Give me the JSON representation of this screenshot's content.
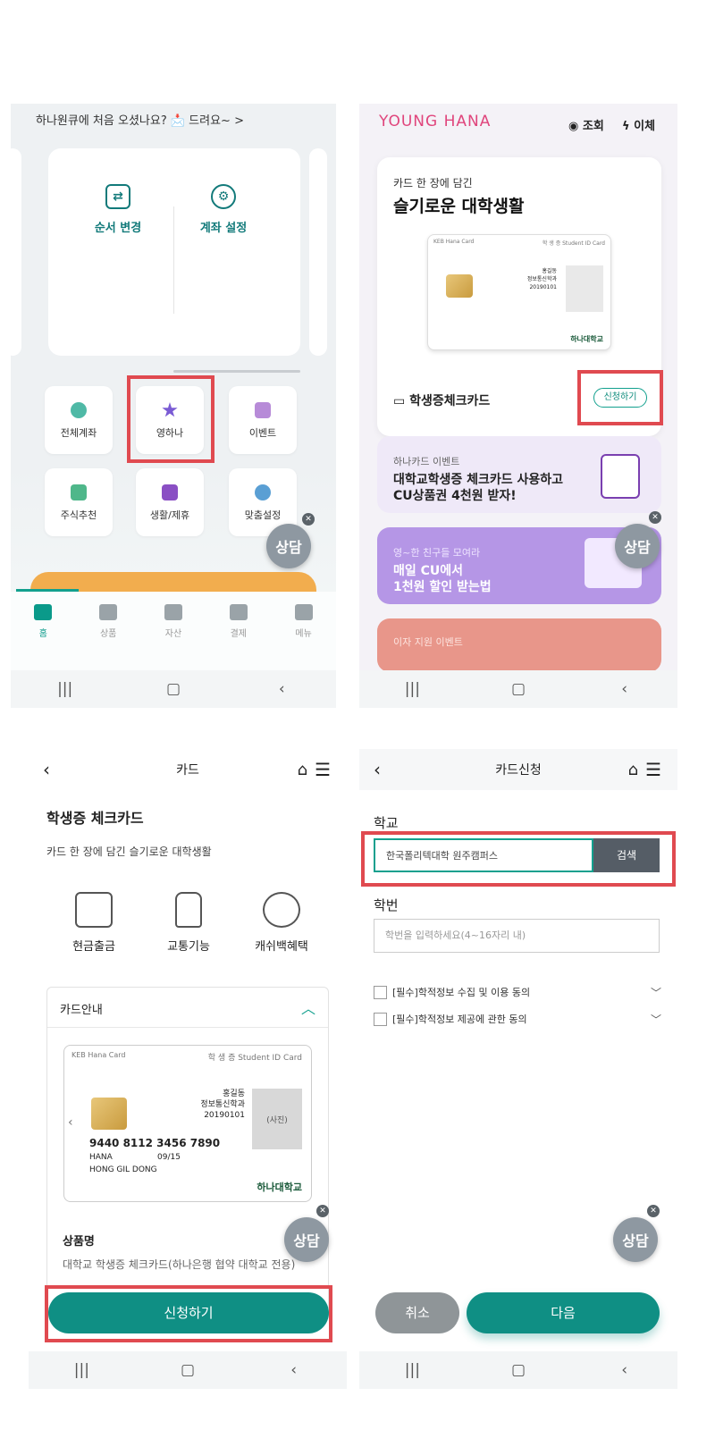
{
  "panel1": {
    "notice": "하나원큐에 처음 오셨나요? 📩 드려요~ >",
    "actions": [
      "순서 변경",
      "계좌 설정"
    ],
    "tiles": [
      {
        "label": "전체계좌",
        "color": "#4fb9a6"
      },
      {
        "label": "영하나",
        "color": "#7a5bd4"
      },
      {
        "label": "이벤트",
        "color": "#b78bd8"
      },
      {
        "label": "주식추천",
        "color": "#4fb78a"
      },
      {
        "label": "생활/제휴",
        "color": "#8a4fc4"
      },
      {
        "label": "맞춤설정",
        "color": "#5a9fd4"
      }
    ],
    "tabs": [
      "홈",
      "상품",
      "자산",
      "결제",
      "메뉴"
    ],
    "consult": "상담"
  },
  "panel2": {
    "logo": "YOUNG HANA",
    "inquiry": "조회",
    "transfer": "이체",
    "hero_sub": "카드 한 장에 담긴",
    "hero_title": "슬기로운 대학생활",
    "card_brand": "KEB Hana Card",
    "card_type": "학 생 증  Student ID Card",
    "card_holder": "홍길동",
    "card_dept": "정보통신학과",
    "card_id": "20190101",
    "card_univ": "하나대학교",
    "product": "학생증체크카드",
    "apply": "신청하기",
    "banner1_small": "하나카드 이벤트",
    "banner1_line1": "대학교학생증 체크카드 사용하고",
    "banner1_line2": "CU상품권 4천원 받자!",
    "banner2_small": "영~한 친구들 모여라",
    "banner2_line1": "매일 CU에서",
    "banner2_line2": "1천원 할인 받는법",
    "banner3_small": "이자 지원 이벤트",
    "consult": "상담"
  },
  "panel3": {
    "header": "카드",
    "name": "학생증 체크카드",
    "desc": "카드 한 장에 담긴 슬기로운 대학생활",
    "features": [
      "현금출금",
      "교통기능",
      "캐쉬백혜택"
    ],
    "guide": "카드안내",
    "card_brand": "KEB Hana Card",
    "card_type": "학 생 증  Student ID Card",
    "card_holder": "홍길동",
    "card_dept": "정보통신학과",
    "card_id": "20190101",
    "card_photo": "(사진)",
    "card_number": "9440 8112 3456 7890",
    "card_bank": "HANA",
    "card_exp": "09/15",
    "card_name": "HONG GIL DONG",
    "card_univ": "하나대학교",
    "product_label": "상품명",
    "product_value": "대학교 학생증 체크카드(하나은행 협약 대학교 전용)",
    "apply": "신청하기",
    "consult": "상담"
  },
  "panel4": {
    "header": "카드신청",
    "school_label": "학교",
    "school_value": "한국폴리텍대학 원주캠퍼스",
    "search": "검색",
    "id_label": "학번",
    "id_placeholder": "학번을 입력하세요(4~16자리 내)",
    "agree1": "[필수]학적정보 수집 및 이용 동의",
    "agree2": "[필수]학적정보 제공에 관한 동의",
    "cancel": "취소",
    "next": "다음",
    "consult": "상담"
  }
}
